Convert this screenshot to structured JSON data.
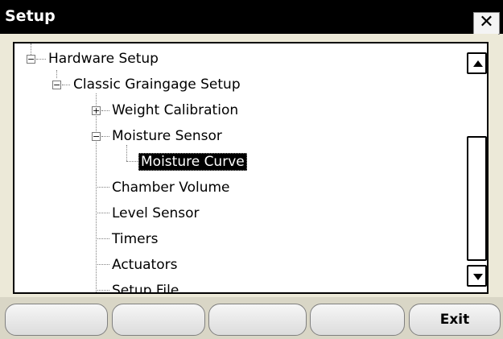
{
  "window": {
    "title": "Setup",
    "close_glyph": "✕"
  },
  "tree": {
    "nodes": [
      {
        "label": "Hardware Setup",
        "expander": "−"
      },
      {
        "label": "Classic Graingage Setup",
        "expander": "−"
      },
      {
        "label": "Weight Calibration",
        "expander": "+"
      },
      {
        "label": "Moisture Sensor",
        "expander": "−"
      },
      {
        "label": "Moisture Curve",
        "selected": true
      },
      {
        "label": "Chamber Volume"
      },
      {
        "label": "Level Sensor"
      },
      {
        "label": "Timers"
      },
      {
        "label": "Actuators"
      },
      {
        "label": "Setup File"
      }
    ]
  },
  "scrollbar": {
    "up_icon": "arrow-up",
    "down_icon": "arrow-down"
  },
  "softkeys": [
    {
      "label": ""
    },
    {
      "label": ""
    },
    {
      "label": ""
    },
    {
      "label": ""
    },
    {
      "label": "Exit"
    }
  ]
}
